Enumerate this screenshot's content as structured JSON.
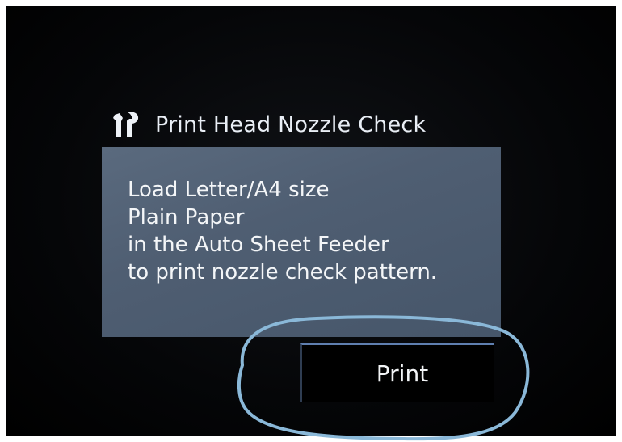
{
  "screen": {
    "title": "Print Head Nozzle Check",
    "title_icon": "maintenance-tools-icon",
    "message_lines": [
      "Load Letter/A4 size",
      "Plain Paper",
      "in the Auto Sheet Feeder",
      "to print nozzle check pattern."
    ],
    "print_button_label": "Print"
  },
  "colors": {
    "screen_background": "#000000",
    "panel": "#52627a",
    "text": "#f4f6f8",
    "annotation_circle": "#8ab8d8"
  }
}
